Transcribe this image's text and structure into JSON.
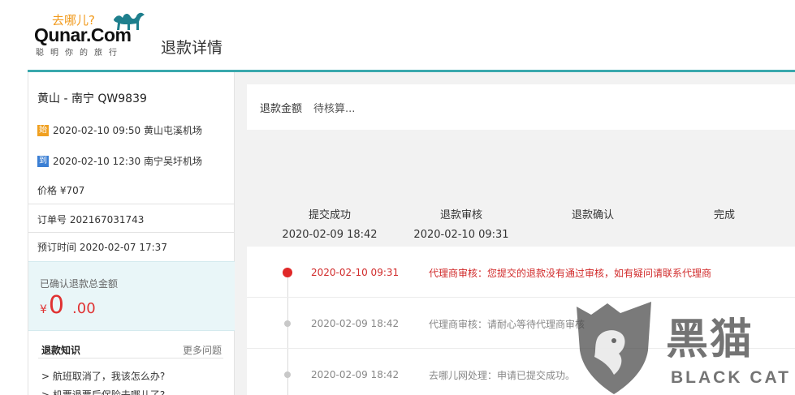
{
  "header": {
    "logo_cn": "去哪儿?",
    "logo_en": "Qunar.Com",
    "logo_sub": "聪明你的旅行",
    "page_title": "退款详情"
  },
  "flight": {
    "route": "黄山 - 南宁 QW9839",
    "departure": {
      "badge": "始",
      "text": "2020-02-10 09:50 黄山屯溪机场"
    },
    "arrival": {
      "badge": "到",
      "text": "2020-02-10 12:30 南宁吴圩机场"
    },
    "price": "价格 ¥707",
    "order_no": "订单号 202167031743",
    "order_time": "预订时间 2020-02-07 17:37"
  },
  "refund_summary": {
    "label": "已确认退款总金额",
    "currency": "¥",
    "integer": "0",
    "decimal": ".00"
  },
  "knowledge": {
    "title": "退款知识",
    "more": "更多问题",
    "faqs": [
      "> 航班取消了，我该怎么办?",
      "> 机票退票后保险去哪儿了?"
    ]
  },
  "amount": {
    "label": "退款金额",
    "value": "待核算..."
  },
  "steps": [
    {
      "name": "提交成功",
      "time": "2020-02-09 18:42"
    },
    {
      "name": "退款审核",
      "time": "2020-02-10 09:31"
    },
    {
      "name": "退款确认",
      "time": ""
    },
    {
      "name": "完成",
      "time": ""
    }
  ],
  "timeline": [
    {
      "time": "2020-02-10 09:31",
      "message": "代理商审核：您提交的退款没有通过审核，如有疑问请联系代理商",
      "status": "active"
    },
    {
      "time": "2020-02-09 18:42",
      "message": "代理商审核：请耐心等待代理商审核",
      "status": "past"
    },
    {
      "time": "2020-02-09 18:42",
      "message": "去哪儿网处理：申请已提交成功。",
      "status": "past"
    }
  ],
  "watermark": {
    "cn": "黑猫",
    "en": "BLACK CAT"
  },
  "colors": {
    "accent": "#3aa8ad",
    "alert_red": "#d12b2b",
    "refund_box_bg": "#e9f6f8"
  }
}
